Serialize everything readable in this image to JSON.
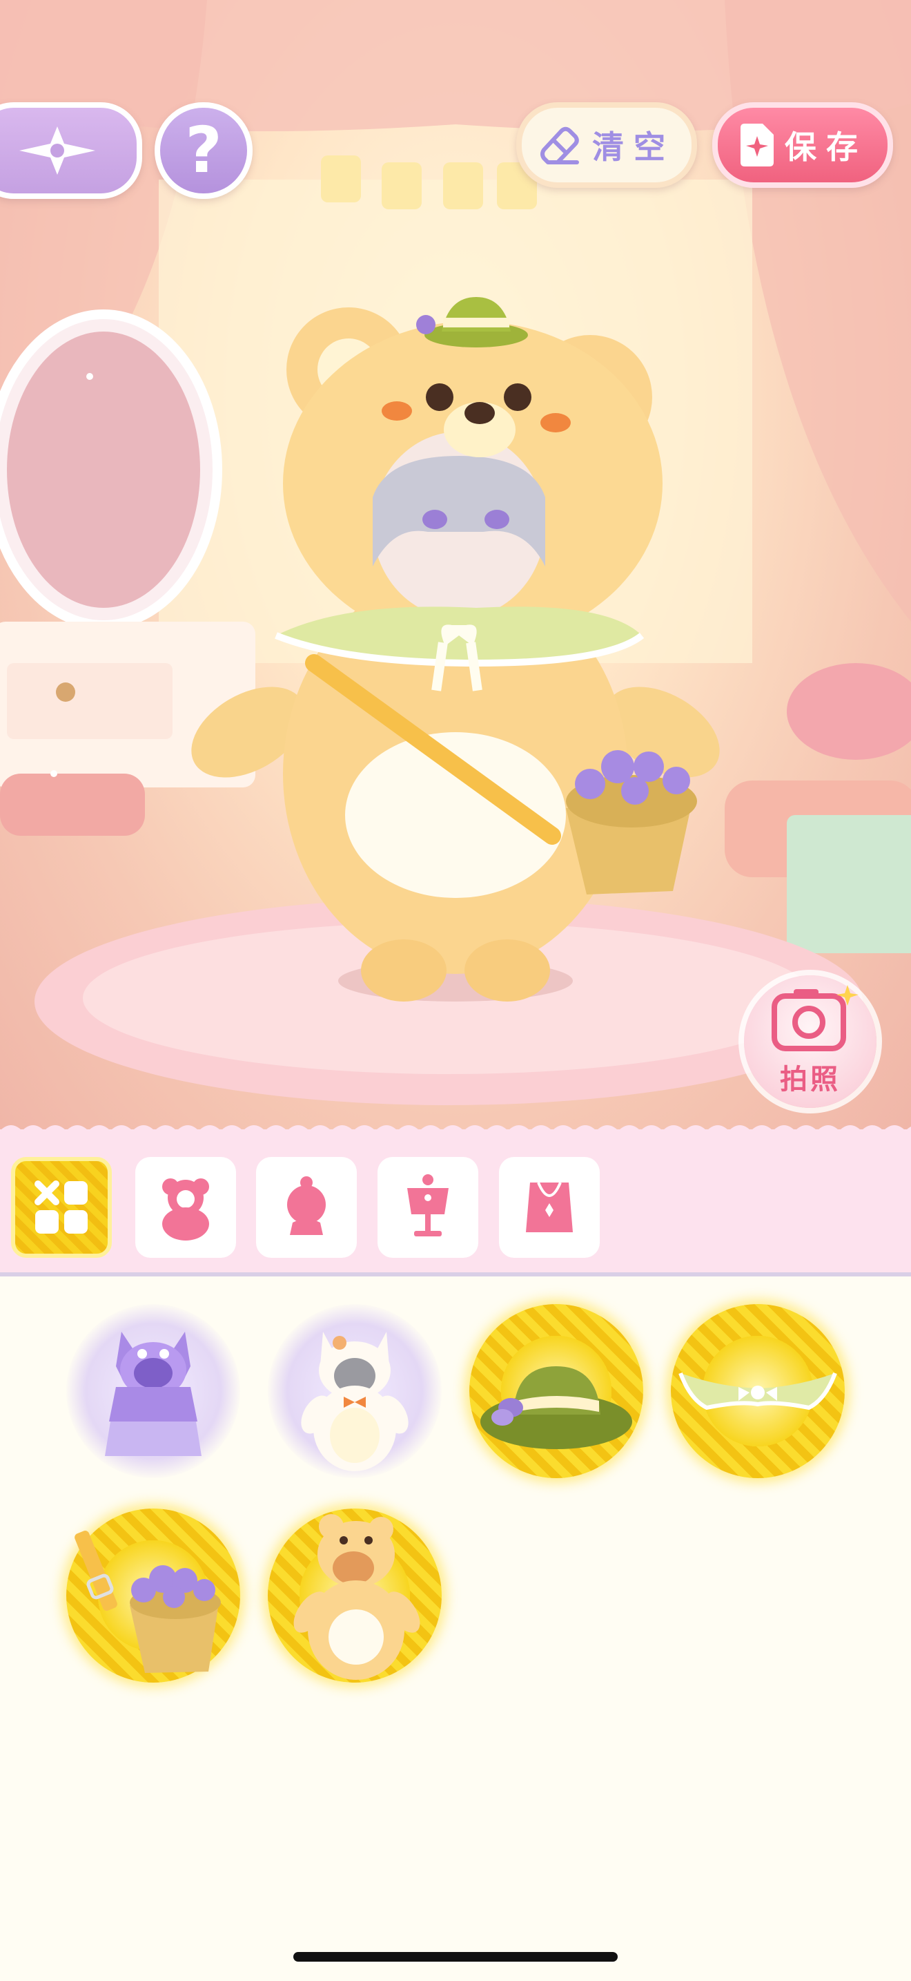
{
  "header": {
    "back_icon": "compass-star-icon",
    "help_icon": "question-icon",
    "help_label": "?",
    "clear_label": "清空",
    "clear_icon": "eraser-icon",
    "save_label": "保存",
    "save_icon": "save-file-icon"
  },
  "photo_button": {
    "label": "拍照",
    "icon": "camera-icon"
  },
  "tabs": [
    {
      "name": "all",
      "icon": "grid-icon",
      "active": true
    },
    {
      "name": "suit",
      "icon": "bear-suit-icon",
      "active": false
    },
    {
      "name": "hair",
      "icon": "hair-bust-icon",
      "active": false
    },
    {
      "name": "outfit",
      "icon": "mannequin-icon",
      "active": false
    },
    {
      "name": "accessory",
      "icon": "necklace-icon",
      "active": false
    }
  ],
  "items": [
    {
      "name": "purple-cat-hoodie",
      "owned": false
    },
    {
      "name": "white-cat-costume",
      "owned": false
    },
    {
      "name": "green-hat",
      "owned": true
    },
    {
      "name": "plaid-collar-cape",
      "owned": true
    },
    {
      "name": "flower-basket-bag",
      "owned": true
    },
    {
      "name": "yellow-bear-costume",
      "owned": true
    }
  ],
  "colors": {
    "accent_pink": "#f0627f",
    "accent_purple": "#c5a1e2",
    "selected_yellow": "#f8d21f",
    "tabbar_bg": "#fde2ee"
  }
}
